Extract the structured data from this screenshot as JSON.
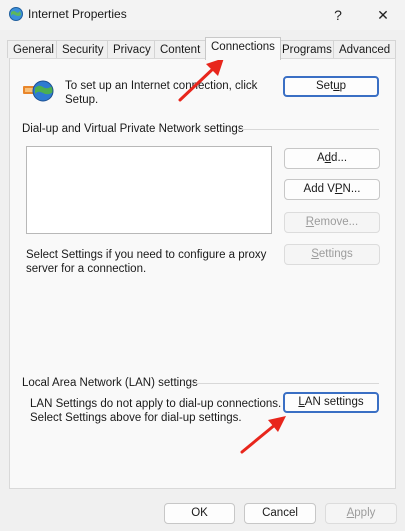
{
  "window": {
    "title": "Internet Properties",
    "help_glyph": "?",
    "close_glyph": "✕"
  },
  "tabs": [
    {
      "label": "General",
      "active": false
    },
    {
      "label": "Security",
      "active": false
    },
    {
      "label": "Privacy",
      "active": false
    },
    {
      "label": "Content",
      "active": false
    },
    {
      "label": "Connections",
      "active": true
    },
    {
      "label": "Programs",
      "active": false
    },
    {
      "label": "Advanced",
      "active": false
    }
  ],
  "setup": {
    "text_line1": "To set up an Internet connection, click",
    "text_line2": "Setup.",
    "button_pre": "Set",
    "button_u": "u",
    "button_post": "p"
  },
  "dialup": {
    "heading": "Dial-up and Virtual Private Network settings",
    "add_pre": "A",
    "add_u": "d",
    "add_post": "d...",
    "addvpn_pre": "Add V",
    "addvpn_u": "P",
    "addvpn_post": "N...",
    "remove_pre": "",
    "remove_u": "R",
    "remove_post": "emove...",
    "settings_pre": "",
    "settings_u": "S",
    "settings_post": "ettings",
    "proxy_text_line1": "Select Settings if you need to configure a proxy",
    "proxy_text_line2": "server for a connection."
  },
  "lan": {
    "heading": "Local Area Network (LAN) settings",
    "text_line1": "LAN Settings do not apply to dial-up connections.",
    "text_line2": "Select Settings above for dial-up settings.",
    "button_pre": "",
    "button_u": "L",
    "button_post": "AN settings"
  },
  "footer": {
    "ok_label": "OK",
    "cancel_label": "Cancel",
    "apply_pre": "",
    "apply_u": "A",
    "apply_post": "pply"
  },
  "colors": {
    "arrow": "#e8261c",
    "primary_border": "#3a6fc4"
  }
}
